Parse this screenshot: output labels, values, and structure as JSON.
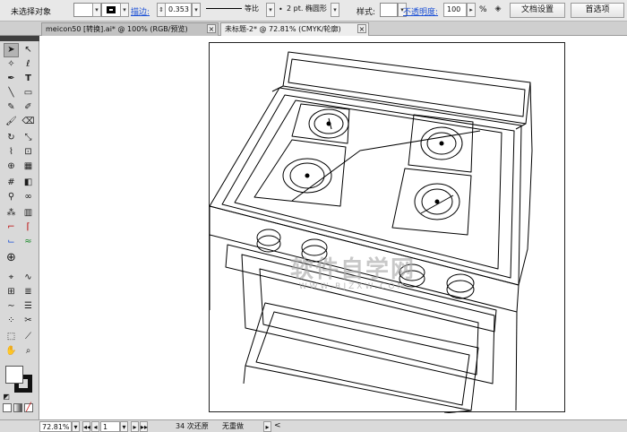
{
  "control_bar": {
    "selection_label": "未选择对象",
    "fill_label": "",
    "stroke_label": "描边:",
    "stroke_weight": "0.353",
    "stroke_profile": "等比",
    "brush_size": "2 pt. 椭圆形",
    "style_label": "样式:",
    "opacity_label": "不透明度:",
    "opacity_value": "100",
    "percent_sign": "%",
    "doc_setup_button": "文档设置",
    "preferences_button": "首选项"
  },
  "tabs": [
    {
      "label": "meicon50 [转换].ai* @ 100% (RGB/预览)",
      "active": false
    },
    {
      "label": "未标题-2* @ 72.81% (CMYK/轮廓)",
      "active": true
    }
  ],
  "watermark": {
    "title": "软件自学网",
    "subtitle": "WWW.RJZXW.COM"
  },
  "status_bar": {
    "zoom": "72.81%",
    "page": "1",
    "undo_info": "34 次还原",
    "redo_info": "无重做"
  },
  "colors": {
    "control_bg": "#e8e8e8",
    "tabbar_bg": "#cfcfcf",
    "panel_bg": "#d9d9d9",
    "link_blue": "#1a4fd6",
    "canvas_bg": "#ffffff",
    "outline": "#000000"
  }
}
